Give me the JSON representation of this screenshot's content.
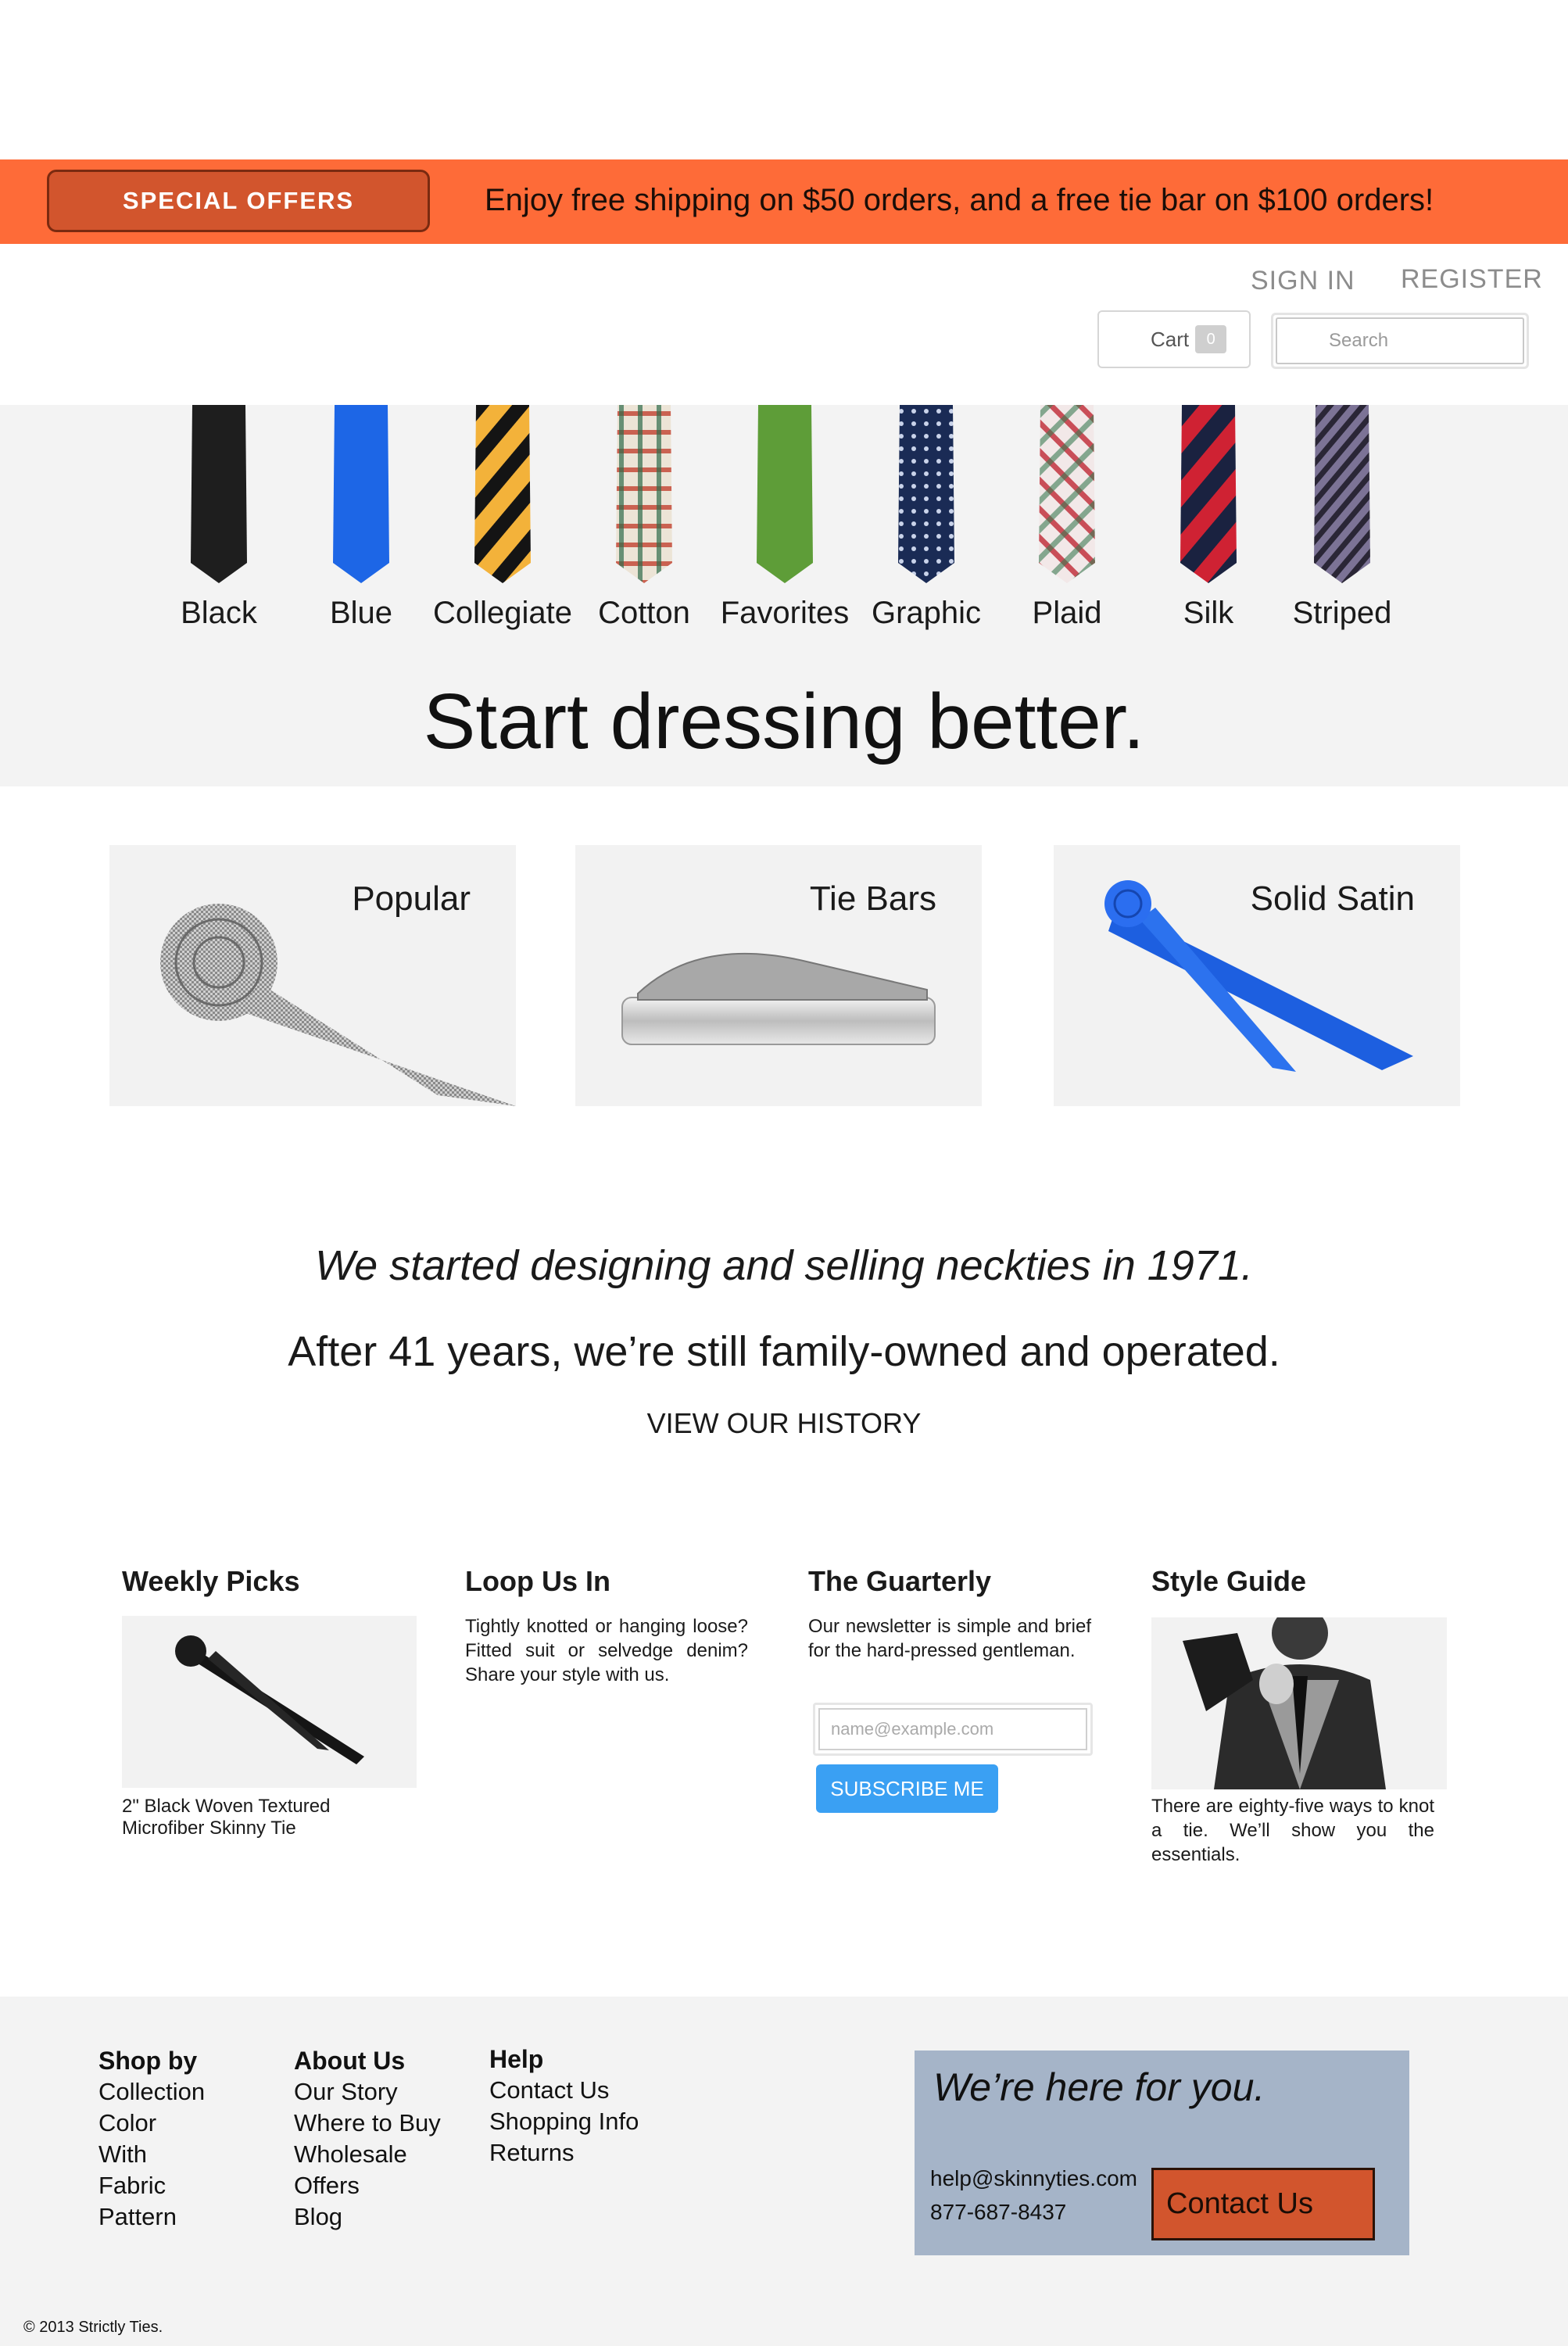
{
  "promo": {
    "button_label": "SPECIAL OFFERS",
    "message": "Enjoy free shipping on $50 orders, and a free tie bar on $100 orders!"
  },
  "header": {
    "sign_in": "SIGN IN",
    "register": "REGISTER",
    "cart_label": "Cart",
    "cart_count": "0",
    "search_placeholder": "Search"
  },
  "hero": {
    "ties": [
      {
        "label": "Black",
        "colors": [
          "#1c1c1c",
          "#2e2e2e"
        ]
      },
      {
        "label": "Blue",
        "colors": [
          "#1b63e3",
          "#2f7ff0"
        ]
      },
      {
        "label": "Collegiate",
        "colors": [
          "#f3b23a",
          "#141414"
        ]
      },
      {
        "label": "Cotton",
        "colors": [
          "#e8e0d2",
          "#c2412f"
        ]
      },
      {
        "label": "Favorites",
        "colors": [
          "#5b9a35",
          "#6aaa3e"
        ]
      },
      {
        "label": "Graphic",
        "colors": [
          "#1a2b55",
          "#c9d3ea"
        ]
      },
      {
        "label": "Plaid",
        "colors": [
          "#f0e6e6",
          "#c2323e"
        ]
      },
      {
        "label": "Silk",
        "colors": [
          "#cf2233",
          "#1a2240"
        ]
      },
      {
        "label": "Striped",
        "colors": [
          "#7c7396",
          "#2a2636"
        ]
      }
    ],
    "title": "Start dressing better."
  },
  "categories": [
    {
      "label": "Popular"
    },
    {
      "label": "Tie Bars"
    },
    {
      "label": "Solid Satin"
    }
  ],
  "about": {
    "line1": "We started designing and selling neckties in 1971.",
    "line2": "After 41 years, we’re still family-owned and operated.",
    "link": "VIEW OUR HISTORY"
  },
  "columns": {
    "weekly": {
      "title": "Weekly Picks",
      "caption": "2\" Black Woven Textured Microfiber Skinny Tie"
    },
    "loop": {
      "title": "Loop Us In",
      "text": "Tightly knotted or hanging loose? Fitted suit or selvedge denim? Share your style with us."
    },
    "quarterly": {
      "title": "The Guarterly",
      "text": "Our newsletter is simple and brief for the hard-pressed gentleman.",
      "email_placeholder": "name@example.com",
      "subscribe": "SUBSCRIBE ME"
    },
    "style": {
      "title": "Style Guide",
      "text": "There are eighty-five ways to knot a tie. We’ll show you the essentials."
    }
  },
  "footer": {
    "shop": {
      "heading": "Shop by",
      "links": [
        "Collection",
        "Color",
        "With",
        "Fabric",
        "Pattern"
      ]
    },
    "about": {
      "heading": "About Us",
      "links": [
        "Our Story",
        "Where to Buy",
        "Wholesale",
        "Offers",
        "Blog"
      ]
    },
    "help": {
      "heading": "Help",
      "links": [
        "Contact Us",
        "Shopping Info",
        "Returns"
      ]
    },
    "contact": {
      "title": "We’re here for you.",
      "email": "help@skinnyties.com",
      "phone": "877-687-8437",
      "button": "Contact Us"
    },
    "copyright": "© 2013 Strictly Ties."
  }
}
